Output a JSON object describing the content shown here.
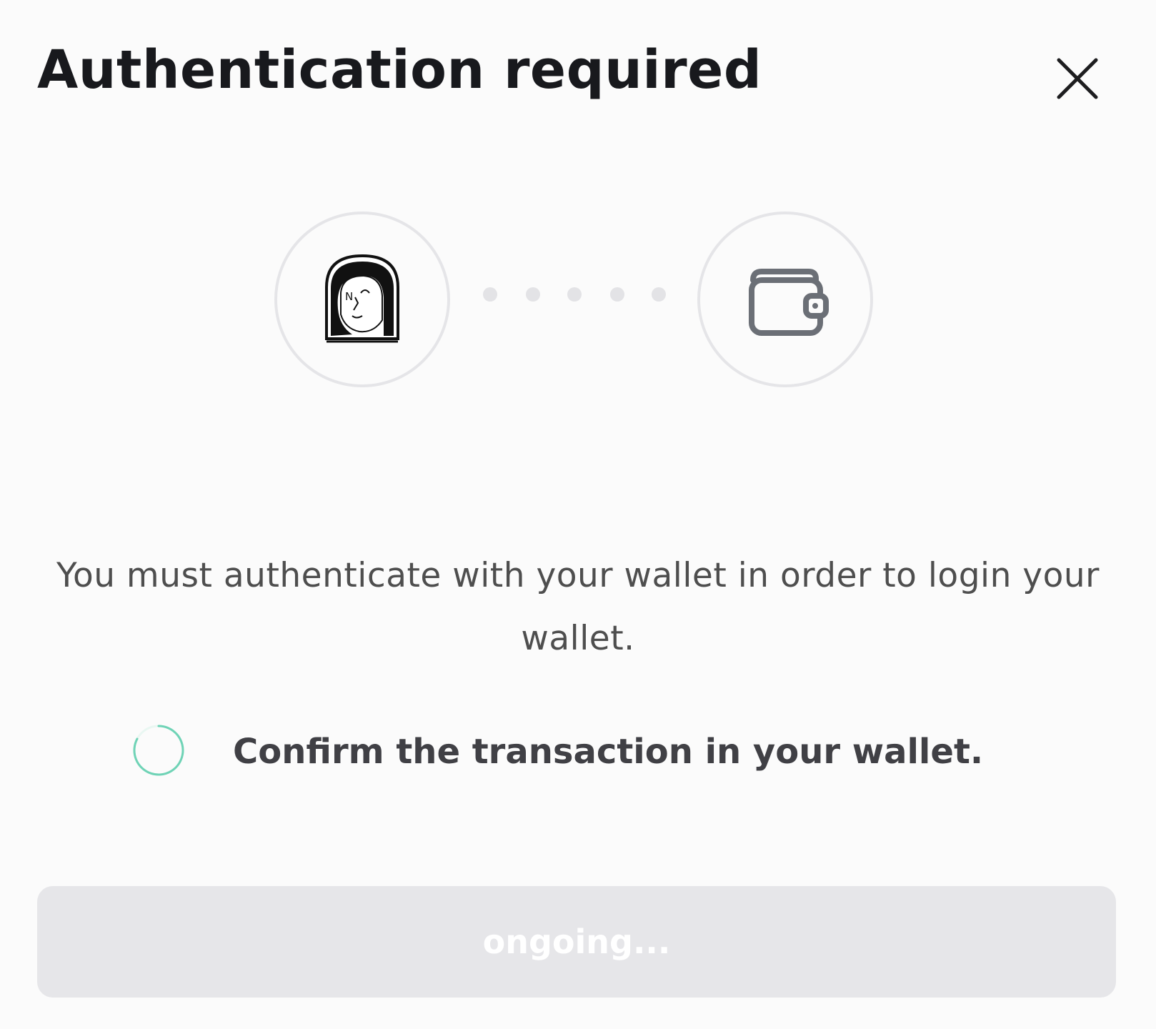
{
  "modal": {
    "title": "Authentication required",
    "close_icon": "close-icon"
  },
  "connection": {
    "left_icon": "nft-portrait-avatar",
    "right_icon": "wallet-icon",
    "dots_count": 5
  },
  "description": "You must authenticate with your wallet in order to login your wallet.",
  "status": {
    "icon": "loading-spinner-icon",
    "text": "Confirm the transaction in your wallet."
  },
  "action_button": {
    "label": "ongoing..."
  },
  "colors": {
    "background": "#fbfbfb",
    "title": "#18191d",
    "body_text": "#4e4e4e",
    "spinner_accent": "#6fd3b6",
    "button_disabled_bg": "#e6e6e9",
    "button_text": "#ffffff",
    "dot": "#e3e3e6",
    "circle_border": "#e5e5e8",
    "wallet_icon": "#6b6f76"
  }
}
